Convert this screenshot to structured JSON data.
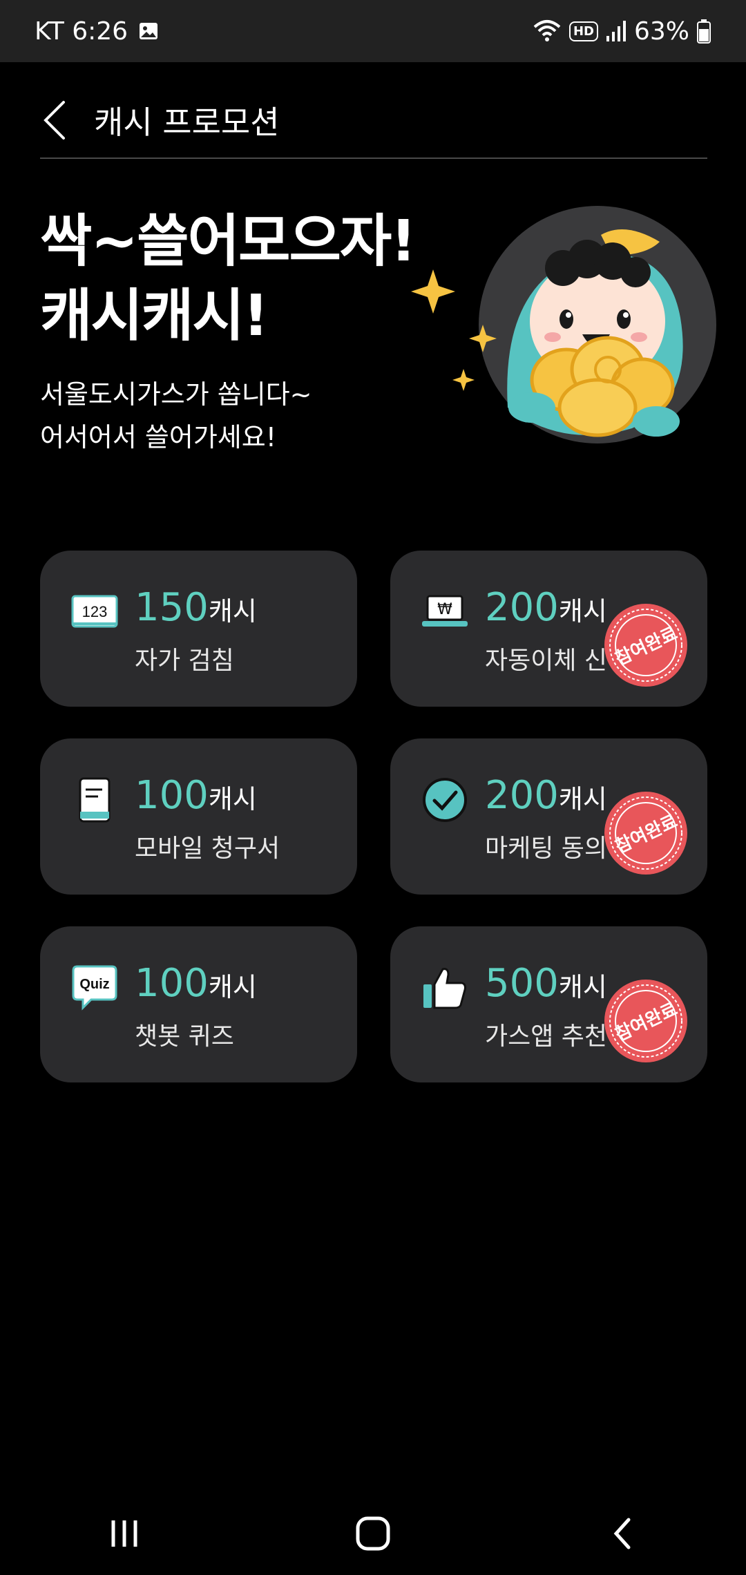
{
  "status_bar": {
    "carrier_time": "KT 6:26",
    "icons": [
      "image-icon",
      "wifi-icon",
      "hd-icon",
      "signal-icon",
      "battery-icon"
    ],
    "hd_label": "HD",
    "battery": "63%"
  },
  "header": {
    "back_icon": "chevron-left-icon",
    "title": "캐시 프로모션"
  },
  "hero": {
    "title_line1": "싹~쓸어모으자!",
    "title_line2": "캐시캐시!",
    "sub_line1": "서울도시가스가 쏩니다~",
    "sub_line2": "어서어서 쓸어가세요!"
  },
  "cards": [
    {
      "icon": "meter-123-icon",
      "icon_text": "123",
      "amount": "150",
      "unit": "캐시",
      "label": "자가 검침",
      "stamp": null
    },
    {
      "icon": "laptop-won-icon",
      "icon_text": "₩",
      "amount": "200",
      "unit": "캐시",
      "label": "자동이체 신청",
      "stamp": "참여완료"
    },
    {
      "icon": "mobile-bill-icon",
      "amount": "100",
      "unit": "캐시",
      "label": "모바일 청구서",
      "stamp": null
    },
    {
      "icon": "check-circle-icon",
      "amount": "200",
      "unit": "캐시",
      "label": "마케팅 동의",
      "stamp": "참여완료"
    },
    {
      "icon": "quiz-bubble-icon",
      "icon_text": "Quiz",
      "amount": "100",
      "unit": "캐시",
      "label": "챗봇 퀴즈",
      "stamp": null
    },
    {
      "icon": "thumbs-up-icon",
      "amount": "500",
      "unit": "캐시",
      "label": "가스앱 추천",
      "stamp": "참여완료"
    }
  ],
  "colors": {
    "accent": "#5fd0c0",
    "card_bg": "#2b2b2d",
    "stamp": "#e8565a"
  },
  "nav": [
    "recent-apps-icon",
    "home-icon",
    "back-icon"
  ]
}
